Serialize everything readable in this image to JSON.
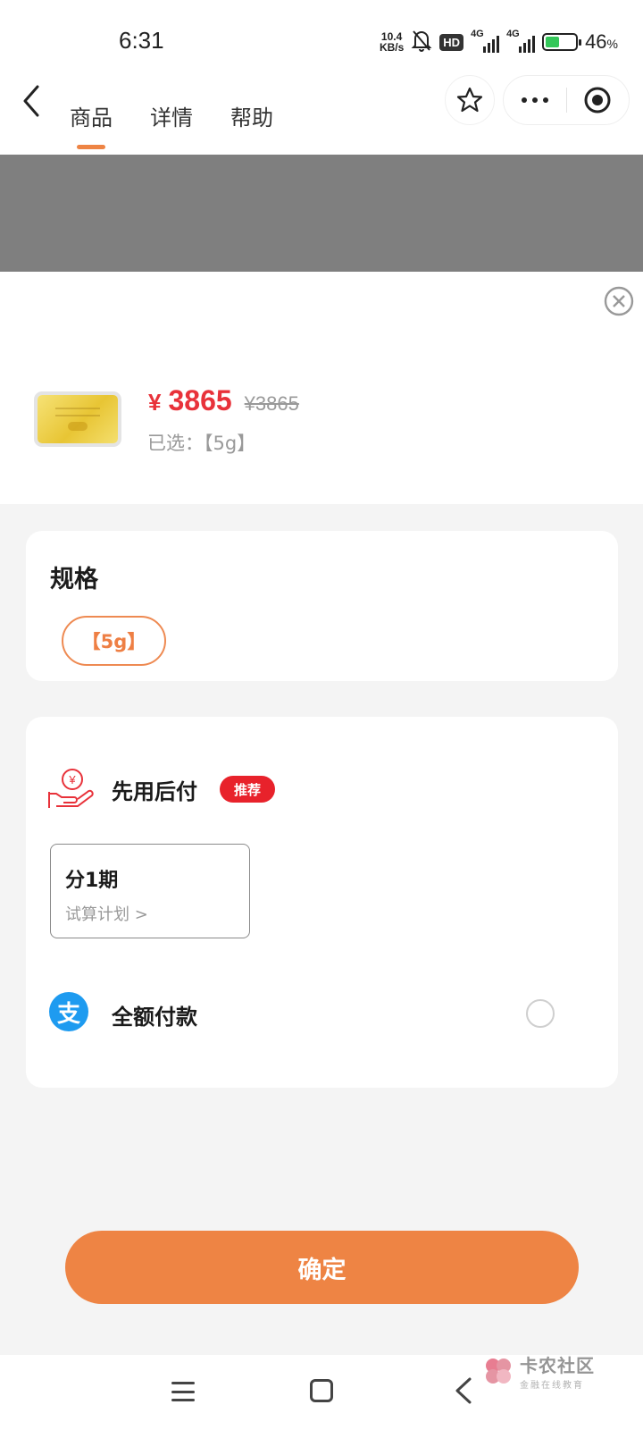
{
  "status_bar": {
    "time": "6:31",
    "net_speed_value": "10.4",
    "net_speed_unit": "KB/s",
    "hd_label": "HD",
    "signal_1_label": "4G",
    "signal_2_label": "4G",
    "battery_percent": "46",
    "battery_unit": "%",
    "battery_level": 0.46
  },
  "nav": {
    "tabs": [
      {
        "label": "商品",
        "active": true
      },
      {
        "label": "详情",
        "active": false
      },
      {
        "label": "帮助",
        "active": false
      }
    ],
    "icons": [
      "back-icon",
      "star-icon",
      "more-icon",
      "target-icon"
    ]
  },
  "product": {
    "currency": "¥",
    "price": "3865",
    "original_price": "¥3865",
    "selected_label": "已选：【5g】"
  },
  "spec": {
    "title": "规格",
    "option": "【5g】"
  },
  "payment": {
    "bnpl_label": "先用后付",
    "recommend_badge": "推荐",
    "plan_title": "分1期",
    "plan_link": "试算计划 >",
    "alipay_glyph": "支",
    "full_payment_label": "全额付款"
  },
  "confirm_label": "确定",
  "watermark": {
    "main": "卡农社区",
    "sub": "金融在线教育"
  },
  "colors": {
    "accent": "#ee8444",
    "price_red": "#e8323a",
    "badge_red": "#e8222b",
    "alipay_blue": "#1e9bf0"
  }
}
